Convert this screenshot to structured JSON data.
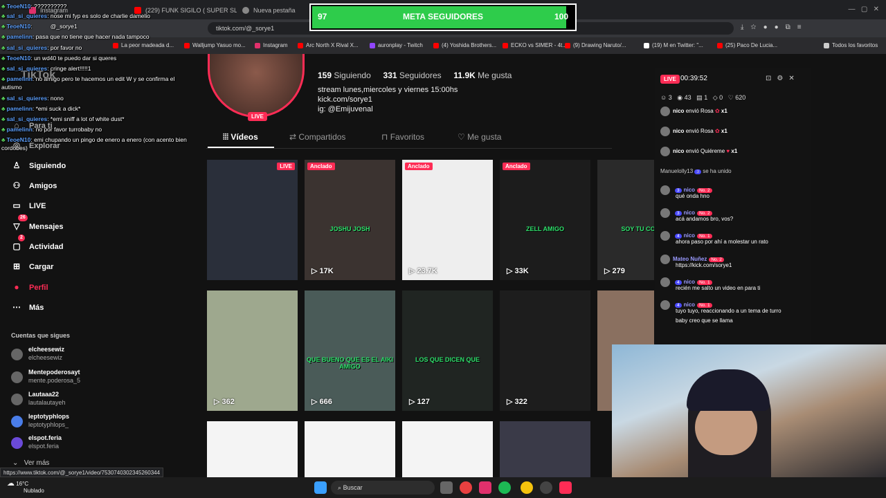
{
  "browser": {
    "tabs": [
      {
        "label": "Instagram",
        "color": "#e1306c"
      },
      {
        "label": "(229) FUNK SIGILO ( SUPER SL",
        "color": "#ff0000"
      },
      {
        "label": "Nueva pestaña",
        "color": "#888888"
      }
    ],
    "url": "tiktok.com/@_sorye1",
    "bookmarks": [
      {
        "label": "La peor madeada d...",
        "color": "#ff0000"
      },
      {
        "label": "Walljump Yasuo mo...",
        "color": "#ff0000"
      },
      {
        "label": "Instagram",
        "color": "#e1306c"
      },
      {
        "label": "Arc North X Rival X...",
        "color": "#ff0000"
      },
      {
        "label": "auronplay - Twitch",
        "color": "#9146ff"
      },
      {
        "label": "(4) Yoshida Brothers...",
        "color": "#ff0000"
      },
      {
        "label": "ECKO vs SIMER - 4t...",
        "color": "#ff0000"
      },
      {
        "label": "(9) Drawing Naruto/...",
        "color": "#ff0000"
      },
      {
        "label": "(19) M en Twitter: \"...",
        "color": "#ffffff"
      },
      {
        "label": "(25) Paco De Lucia...",
        "color": "#ff0000"
      }
    ],
    "all_bookmarks": "Todos los favoritos",
    "status_url": "https://www.tiktok.com/@_sorye1/video/7530740302345260344"
  },
  "goal": {
    "current": "97",
    "title": "META SEGUIDORES",
    "target": "100",
    "progress": 0.97,
    "color": "#2ecc4b"
  },
  "chat_overlay": [
    {
      "user": "TeoeN10",
      "text": ": ??????????"
    },
    {
      "user": "sal_si_quieres",
      "text": ": nose mi fyp es solo de charlie damelio"
    },
    {
      "user": "TeoeN10",
      "text": ":           @_sorye1"
    },
    {
      "user": "pamelinn",
      "text": ": pasa que no tiene que hacer nada tampoco"
    },
    {
      "user": "sal_si_quieres",
      "text": ": por favor no"
    },
    {
      "user": "TeoeN10",
      "text": ": un wd40 te puedo dar si queres"
    },
    {
      "user": "sal_si_quieres",
      "text": ": cringe alert!!!!!1"
    },
    {
      "user": "pamelinn",
      "text": ": no amigo pero te hacemos un edit W y se confirma el"
    },
    {
      "user": "",
      "text": "autismo"
    },
    {
      "user": "sal_si_quieres",
      "text": ": nono"
    },
    {
      "user": "pamelinn",
      "text": ": *emi suck a dick*"
    },
    {
      "user": "sal_si_quieres",
      "text": ": *emi sniff a lot of white dust*"
    },
    {
      "user": "pamelinn",
      "text": ": no por favor turrobaby no"
    },
    {
      "user": "TeoeN10",
      "text": ": emi chupando un pingo de enero a enero (con acento bien"
    },
    {
      "user": "",
      "text": "cordobes)"
    }
  ],
  "sidebar": {
    "items": [
      {
        "label": "Explorar",
        "icon": "compass-icon"
      },
      {
        "label": "Siguiendo",
        "icon": "person-icon"
      },
      {
        "label": "Amigos",
        "icon": "friends-icon"
      },
      {
        "label": "LIVE",
        "icon": "live-icon"
      },
      {
        "label": "Mensajes",
        "icon": "message-icon",
        "badge": "26"
      },
      {
        "label": "Actividad",
        "icon": "activity-icon",
        "badge": "2"
      },
      {
        "label": "Cargar",
        "icon": "plus-icon"
      },
      {
        "label": "Perfil",
        "icon": "avatar-icon"
      },
      {
        "label": "Más",
        "icon": "more-icon"
      }
    ],
    "following_title": "Cuentas que sigues",
    "following": [
      {
        "name": "elcheesewiz",
        "handle": "elcheesewiz"
      },
      {
        "name": "Mentepoderosayt",
        "handle": "mente.poderosa_5"
      },
      {
        "name": "Lautaaa22",
        "handle": "lautalautayeh"
      },
      {
        "name": "leptotyphlops",
        "handle": "leptotyphlops_"
      },
      {
        "name": "elspot.feria",
        "handle": "elspot.feria"
      }
    ],
    "see_more": "Ver más",
    "para_ti": "Para ti"
  },
  "profile": {
    "live_label": "LIVE",
    "following_count": "159",
    "following_label": "Siguiendo",
    "followers_count": "331",
    "followers_label": "Seguidores",
    "likes_count": "11.9K",
    "likes_label": "Me gusta",
    "bio_lines": [
      "stream lunes,miercoles y viernes 15:00hs",
      "kick.com/sorye1",
      "ig: @Emijuvenal"
    ],
    "tabs": [
      "Vídeos",
      "Compartidos",
      "Favoritos",
      "Me gusta"
    ],
    "pinned_label": "Anclado"
  },
  "videos": [
    {
      "views": "",
      "badge": "LIVE",
      "caption": "",
      "bg": "#2a2f3a"
    },
    {
      "views": "17K",
      "badge": "Anclado",
      "caption": "JOSHU JOSH",
      "bg": "#3b3330"
    },
    {
      "views": "23.7K",
      "badge": "Anclado",
      "caption": "",
      "bg": "#eeeeee"
    },
    {
      "views": "33K",
      "badge": "Anclado",
      "caption": "ZELL AMIGO",
      "bg": "#1c1c1c"
    },
    {
      "views": "279",
      "badge": "",
      "caption": "SOY TU COCA",
      "bg": "#2a2a2a"
    },
    {
      "views": "362",
      "badge": "",
      "caption": "",
      "bg": "#9ea88e"
    },
    {
      "views": "666",
      "badge": "",
      "caption": "QUE BUENO QUE ES EL AIKI AMIGO",
      "bg": "#4a5b58"
    },
    {
      "views": "127",
      "badge": "",
      "caption": "LOS QUE DICEN QUE",
      "bg": "#202522"
    },
    {
      "views": "322",
      "badge": "",
      "caption": "",
      "bg": "#1d1d1d"
    },
    {
      "views": "",
      "badge": "",
      "caption": "",
      "bg": "#8a7060"
    },
    {
      "views": "",
      "badge": "",
      "caption": "",
      "bg": "#f4f4f4"
    },
    {
      "views": "",
      "badge": "",
      "caption": "",
      "bg": "#f4f4f4"
    },
    {
      "views": "",
      "badge": "",
      "caption": "",
      "bg": "#f4f4f4"
    },
    {
      "views": "",
      "badge": "",
      "caption": "",
      "bg": "#3a3a48"
    }
  ],
  "live_panel": {
    "live_label": "LIVE",
    "timer": "00:39:52",
    "viewers": "3",
    "views": "43",
    "shares": "1",
    "zero": "0",
    "likes": "620",
    "gifts": [
      {
        "user": "nico",
        "text": "envió Rosa",
        "count": "x1"
      },
      {
        "user": "nico",
        "text": "envió Rosa",
        "count": "x1"
      },
      {
        "user": "nico",
        "text": "envió Quiéreme",
        "count": "x1"
      }
    ],
    "join": {
      "user": "Manuelolly13",
      "level": "3",
      "text": "se ha unido"
    },
    "messages": [
      {
        "user": "nico",
        "level": "3",
        "rank": "No. 2",
        "text": "qué onda hno"
      },
      {
        "user": "nico",
        "level": "3",
        "rank": "No. 2",
        "text": "acá andamos bro, vos?"
      },
      {
        "user": "nico",
        "level": "4",
        "rank": "No. 1",
        "text": "ahora paso por ahí a molestar un rato"
      },
      {
        "user": "Mateo Nuñez",
        "level": "",
        "rank": "No. 2",
        "text": "https://kick.com/sorye1"
      },
      {
        "user": "nico",
        "level": "4",
        "rank": "No. 1",
        "text": "recién me salto un video en para ti"
      },
      {
        "user": "nico",
        "level": "4",
        "rank": "No. 1",
        "text": "tuyo tuyo, reaccionando a un tema de turro"
      },
      {
        "user": "",
        "level": "",
        "rank": "",
        "text": "baby creo que se llama"
      }
    ]
  },
  "taskbar": {
    "temp": "16°C",
    "weather": "Nublado",
    "search": "Buscar"
  }
}
